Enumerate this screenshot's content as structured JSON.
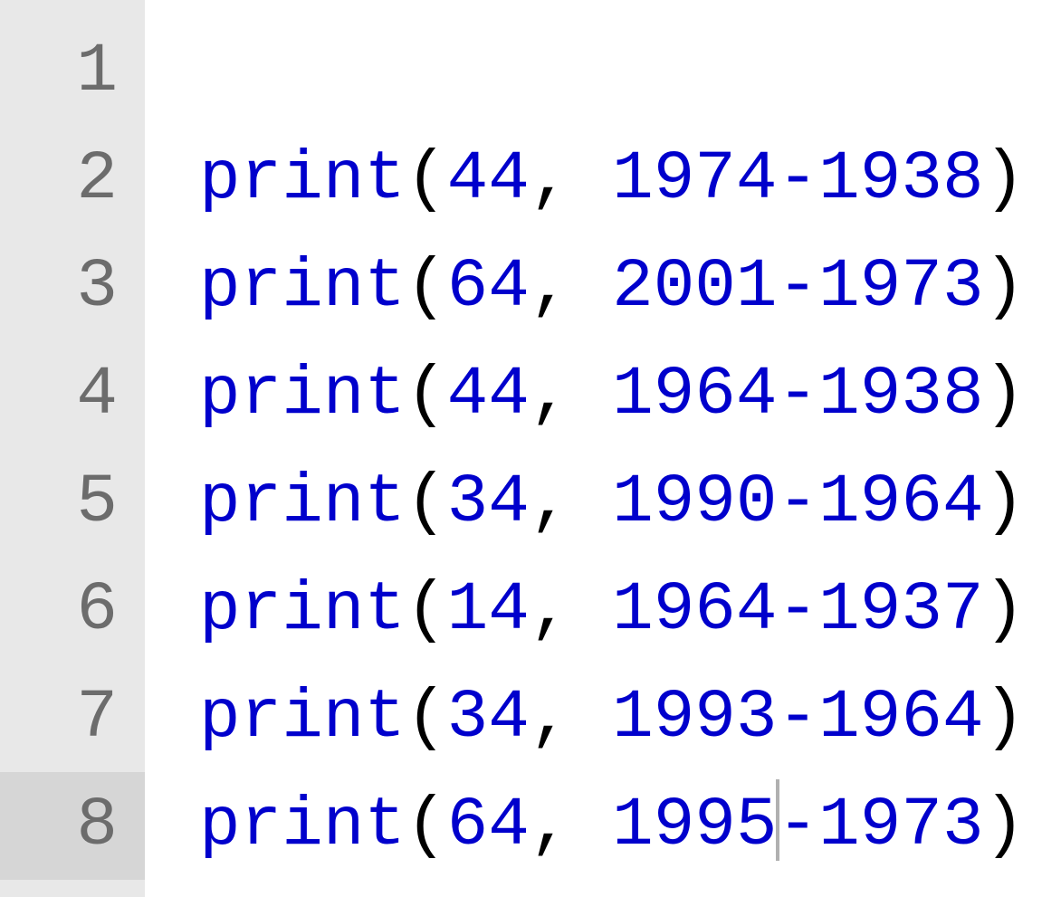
{
  "editor": {
    "lines": [
      {
        "number": "1",
        "func": "",
        "args": "",
        "current": false
      },
      {
        "number": "2",
        "func": "print",
        "a1": "44",
        "a2": "1974",
        "a3": "1938",
        "current": false
      },
      {
        "number": "3",
        "func": "print",
        "a1": "64",
        "a2": "2001",
        "a3": "1973",
        "current": false
      },
      {
        "number": "4",
        "func": "print",
        "a1": "44",
        "a2": "1964",
        "a3": "1938",
        "current": false
      },
      {
        "number": "5",
        "func": "print",
        "a1": "34",
        "a2": "1990",
        "a3": "1964",
        "current": false
      },
      {
        "number": "6",
        "func": "print",
        "a1": "14",
        "a2": "1964",
        "a3": "1937",
        "current": false
      },
      {
        "number": "7",
        "func": "print",
        "a1": "34",
        "a2": "1993",
        "a3": "1964",
        "current": false
      },
      {
        "number": "8",
        "func": "print",
        "a1": "64",
        "a2": "1995",
        "a3": "1973",
        "current": true,
        "cursorAfter": "a2"
      }
    ],
    "punct": {
      "lparen": "(",
      "rparen": ")",
      "comma_space": ", ",
      "minus": "-"
    }
  }
}
